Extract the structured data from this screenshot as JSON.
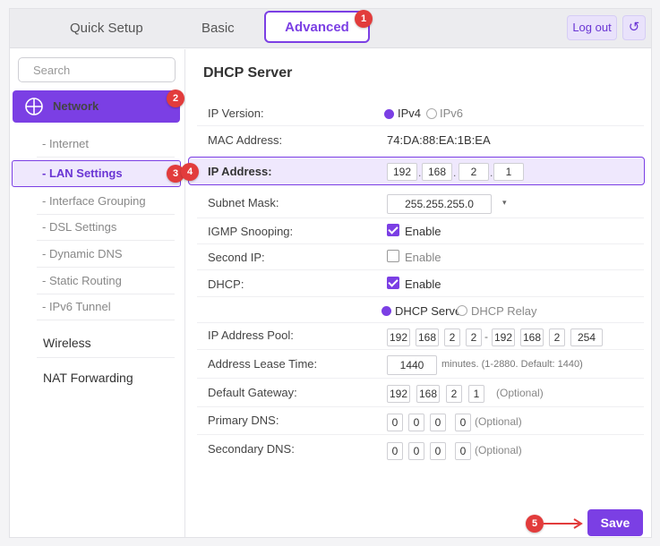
{
  "colors": {
    "accent": "#7b3fe4",
    "marker": "#e23c3c",
    "highlight_bg": "#efe8fd"
  },
  "topbar": {
    "tabs": [
      {
        "label": "Quick Setup"
      },
      {
        "label": "Basic"
      },
      {
        "label": "Advanced",
        "active": true
      }
    ],
    "logout_label": "Log out",
    "refresh_icon": "↺"
  },
  "markers": [
    "1",
    "2",
    "3",
    "4",
    "5"
  ],
  "sidebar": {
    "search_placeholder": "Search",
    "network_label": "Network",
    "network_icon": "globe-icon",
    "subitems": [
      "- Internet",
      "- LAN Settings",
      "- Interface Grouping",
      "- DSL Settings",
      "- Dynamic DNS",
      "- Static Routing",
      "- IPv6 Tunnel"
    ],
    "sections": [
      "Wireless",
      "NAT Forwarding"
    ]
  },
  "main": {
    "title": "DHCP Server",
    "ip_version": {
      "label": "IP Version:",
      "ipv4": "IPv4",
      "ipv6": "IPv6",
      "selected": "IPv4"
    },
    "mac": {
      "label": "MAC Address:",
      "value": "74:DA:88:EA:1B:EA"
    },
    "ip_address": {
      "label": "IP Address:",
      "octets": [
        "192",
        "168",
        "2",
        "1"
      ]
    },
    "subnet": {
      "label": "Subnet Mask:",
      "value": "255.255.255.0",
      "arrow": "▾"
    },
    "igmp": {
      "label": "IGMP Snooping:",
      "text": "Enable",
      "checked": true
    },
    "second_ip": {
      "label": "Second IP:",
      "text": "Enable",
      "checked": false
    },
    "dhcp": {
      "label": "DHCP:",
      "text": "Enable",
      "checked": true
    },
    "dhcp_mode": {
      "server": "DHCP Serve",
      "relay": "DHCP Relay",
      "selected": "server"
    },
    "pool": {
      "label": "IP Address Pool:",
      "start": [
        "192",
        "168",
        "2",
        "2"
      ],
      "separator": "-",
      "end": [
        "192",
        "168",
        "2",
        "254"
      ]
    },
    "lease": {
      "label": "Address Lease Time:",
      "value": "1440",
      "hint": "minutes. (1-2880. Default: 1440)"
    },
    "gateway": {
      "label": "Default Gateway:",
      "octets": [
        "192",
        "168",
        "2",
        "1"
      ],
      "optional": "(Optional)"
    },
    "primary_dns": {
      "label": "Primary DNS:",
      "octets": [
        "0",
        "0",
        "0",
        "0"
      ],
      "optional": "(Optional)"
    },
    "secondary_dns": {
      "label": "Secondary DNS:",
      "octets": [
        "0",
        "0",
        "0",
        "0"
      ],
      "optional": "(Optional)"
    },
    "save_label": "Save"
  }
}
